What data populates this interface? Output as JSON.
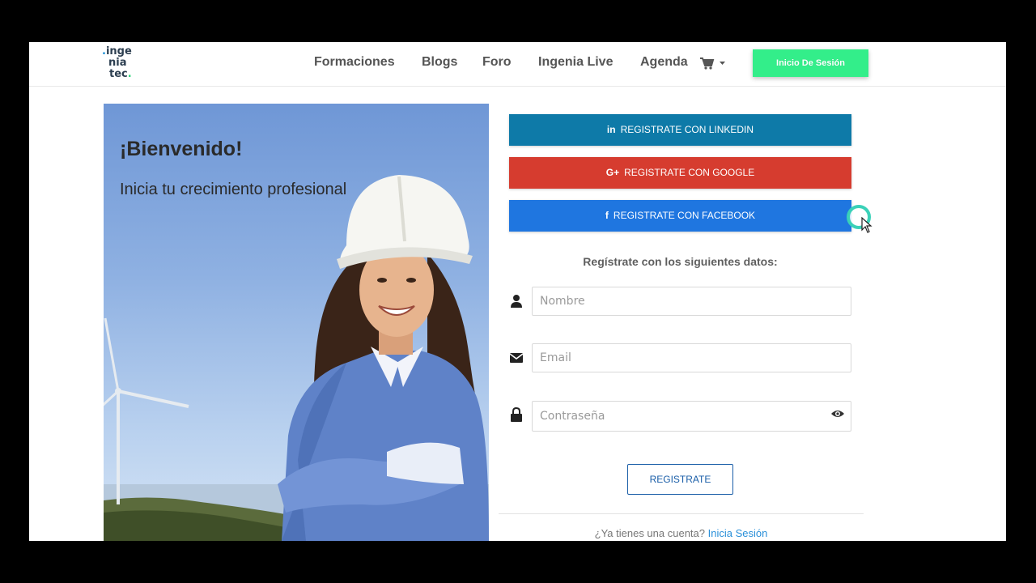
{
  "header": {
    "logo": {
      "line1": "ingenia",
      "line1_prefix": ".",
      "line2": "nia",
      "line3": "tec",
      "line3_suffix": "."
    },
    "nav": [
      {
        "label": "Formaciones"
      },
      {
        "label": "Blogs"
      },
      {
        "label": "Foro"
      },
      {
        "label": "Ingenia Live"
      },
      {
        "label": "Agenda"
      }
    ],
    "cart_icon": "shopping-cart-icon",
    "login_label": "Inicio De Sesión"
  },
  "hero": {
    "title": "¡Bienvenido!",
    "subtitle": "Inicia tu crecimiento profesional"
  },
  "social": {
    "linkedin": {
      "icon": "in",
      "label": "REGISTRATE CON LINKEDIN"
    },
    "google": {
      "icon": "G+",
      "label": "REGISTRATE CON GOOGLE"
    },
    "facebook": {
      "icon": "f",
      "label": "REGISTRATE CON FACEBOOK"
    }
  },
  "form": {
    "heading": "Regístrate con los siguientes datos:",
    "name_placeholder": "Nombre",
    "email_placeholder": "Email",
    "password_placeholder": "Contraseña",
    "submit_label": "REGISTRATE",
    "account_text": "¿Ya tienes una cuenta?",
    "login_link": "Inicia Sesión"
  },
  "colors": {
    "linkedin": "#0e7aa8",
    "google": "#d63c2f",
    "facebook": "#1f76e0",
    "login_button": "#33ee8a",
    "link": "#2b90d9"
  }
}
